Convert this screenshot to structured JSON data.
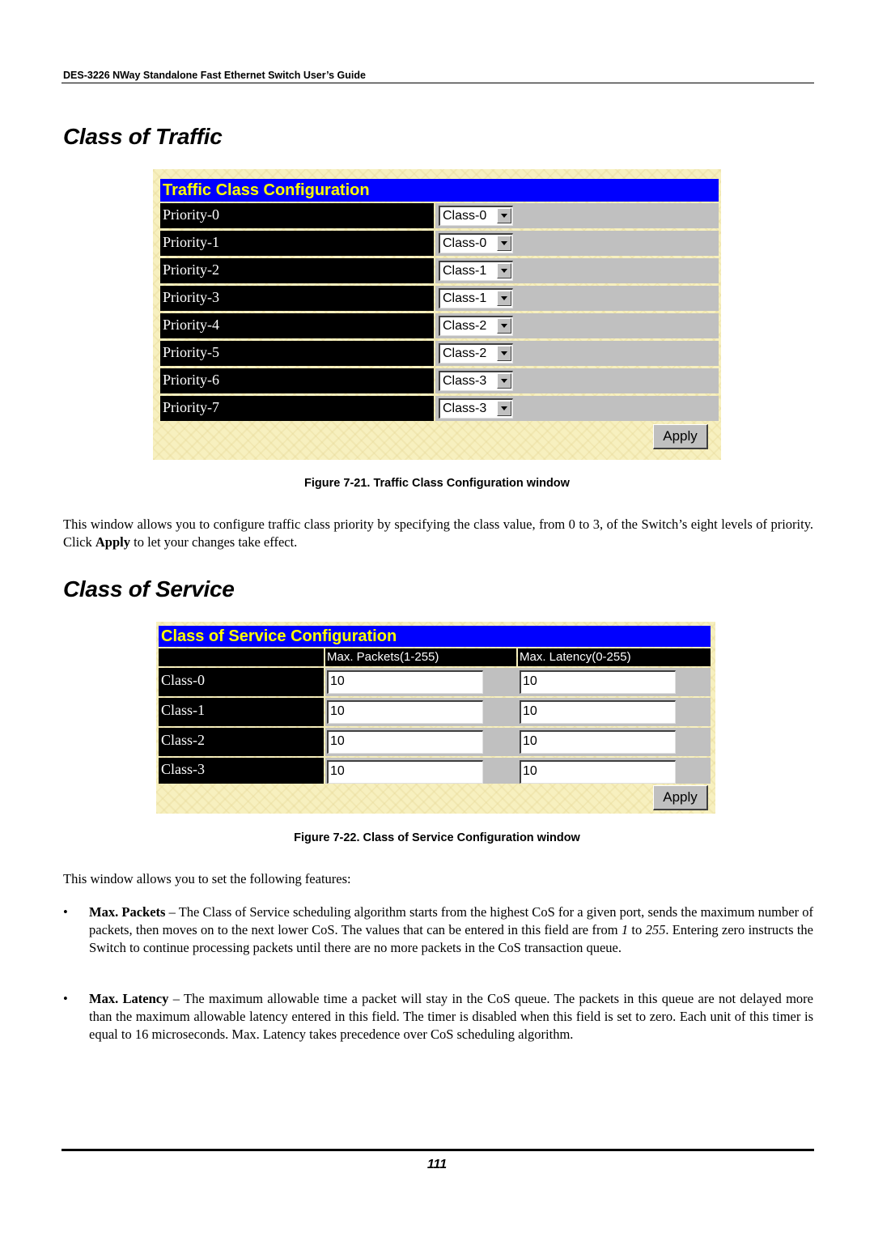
{
  "header": {
    "running_title": "DES-3226 NWay Standalone Fast Ethernet Switch User’s Guide"
  },
  "sections": {
    "traffic": {
      "heading": "Class of Traffic",
      "window": {
        "title": "Traffic Class Configuration",
        "rows": [
          {
            "label": "Priority-0",
            "value": "Class-0"
          },
          {
            "label": "Priority-1",
            "value": "Class-0"
          },
          {
            "label": "Priority-2",
            "value": "Class-1"
          },
          {
            "label": "Priority-3",
            "value": "Class-1"
          },
          {
            "label": "Priority-4",
            "value": "Class-2"
          },
          {
            "label": "Priority-5",
            "value": "Class-2"
          },
          {
            "label": "Priority-6",
            "value": "Class-3"
          },
          {
            "label": "Priority-7",
            "value": "Class-3"
          }
        ],
        "apply_label": "Apply",
        "colors": {
          "title_bg": "#0000ff",
          "title_text": "#ffff00",
          "label_bg": "#000000",
          "value_bg": "#c0c0c0"
        }
      },
      "caption": "Figure 7-21.  Traffic Class Configuration window",
      "paragraph_1": "This window allows you to configure traffic class priority by specifying the class value, from 0 to 3, of the Switch’s eight levels of priority. Click ",
      "paragraph_bold": "Apply",
      "paragraph_2": " to let your changes take effect."
    },
    "service": {
      "heading": "Class of Service",
      "window": {
        "title": "Class of Service Configuration",
        "columns": [
          "",
          "Max. Packets(1-255)",
          "Max. Latency(0-255)"
        ],
        "rows": [
          {
            "label": "Class-0",
            "max_packets": "10",
            "max_latency": "10"
          },
          {
            "label": "Class-1",
            "max_packets": "10",
            "max_latency": "10"
          },
          {
            "label": "Class-2",
            "max_packets": "10",
            "max_latency": "10"
          },
          {
            "label": "Class-3",
            "max_packets": "10",
            "max_latency": "10"
          }
        ],
        "apply_label": "Apply"
      },
      "caption": "Figure 7-22.  Class of Service Configuration window",
      "intro": "This window allows you to set the following features:",
      "bullets": [
        {
          "term": "Max. Packets",
          "text_1": " – The Class of Service scheduling algorithm starts from the highest CoS for a given port, sends the maximum number of packets, then moves on to the next lower CoS. The values that can be entered in this field are from ",
          "italic_1": "1",
          "text_2": " to ",
          "italic_2": "255",
          "text_3": ". Entering zero instructs the Switch to continue processing packets until there are no more packets in the CoS transaction queue."
        },
        {
          "term": "Max. Latency",
          "text_1": " – The maximum allowable time a packet will stay in the CoS queue. The packets in this queue are not delayed more than the maximum allowable latency entered in this field. The timer is disabled when this field is set to zero. Each unit of this timer is equal to 16 microseconds. Max. Latency takes precedence over CoS scheduling algorithm."
        }
      ]
    }
  },
  "footer": {
    "page_number": "111"
  }
}
